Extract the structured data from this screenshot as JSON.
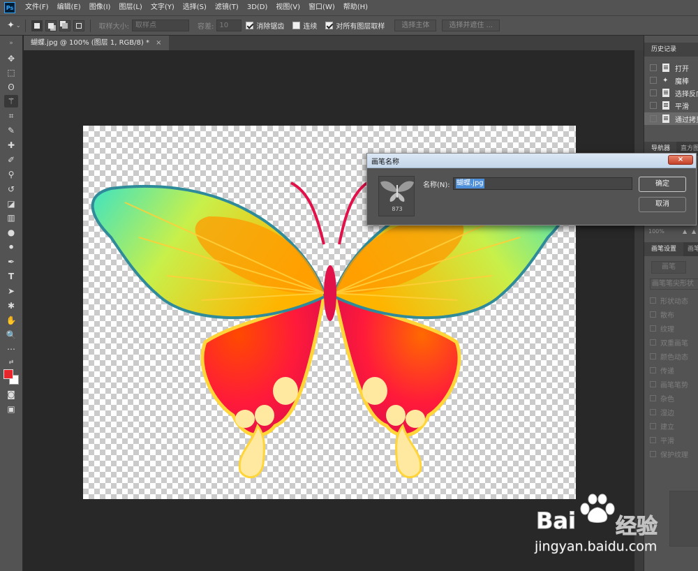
{
  "app": {
    "logo": "Ps"
  },
  "menu": [
    "文件(F)",
    "编辑(E)",
    "图像(I)",
    "图层(L)",
    "文字(Y)",
    "选择(S)",
    "滤镜(T)",
    "3D(D)",
    "视图(V)",
    "窗口(W)",
    "帮助(H)"
  ],
  "options": {
    "tool_icon": "magic-wand-icon",
    "sample_size_label": "取样大小:",
    "sample_size_value": "取样点",
    "tolerance_label": "容差:",
    "tolerance_value": "10",
    "antialias_label": "消除锯齿",
    "antialias_checked": true,
    "contiguous_label": "连续",
    "contiguous_checked": false,
    "all_layers_label": "对所有图层取样",
    "all_layers_checked": true,
    "select_subject": "选择主体",
    "select_mask": "选择并遮住 ..."
  },
  "document": {
    "tab_title": "蝴蝶.jpg @ 100% (图层 1, RGB/8) *",
    "tab_close": "×"
  },
  "colors": {
    "foreground": "#e8272c",
    "background": "#ffffff",
    "dialog_selection": "#4d8ed9"
  },
  "panels": {
    "history_tab": "历史记录",
    "history_items": [
      {
        "label": "打开",
        "icon": "document-icon"
      },
      {
        "label": "魔棒",
        "icon": "magic-wand-icon"
      },
      {
        "label": "选择反向",
        "icon": "document-icon"
      },
      {
        "label": "平滑",
        "icon": "document-icon"
      },
      {
        "label": "通过拷贝的图层",
        "icon": "document-icon"
      }
    ],
    "navigator_tab": "导航器",
    "histogram_tab": "直方图",
    "zoom": "100%",
    "brush_settings_tab": "画笔设置",
    "brush_tab2": "画笔",
    "brush_button": "画笔",
    "brush_tip": "画笔笔尖形状",
    "brush_options": [
      "形状动态",
      "散布",
      "纹理",
      "双重画笔",
      "颜色动态",
      "传递",
      "画笔笔势",
      "杂色",
      "湿边",
      "建立",
      "平滑",
      "保护纹理"
    ]
  },
  "dialog": {
    "title": "画笔名称",
    "close": "×",
    "name_label": "名称(N):",
    "name_value": "蝴蝶.jpg",
    "brush_size": "873",
    "ok": "确定",
    "cancel": "取消"
  },
  "watermark": {
    "brand_latin": "Bai",
    "brand_cn": "经验",
    "url": "jingyan.baidu.com"
  }
}
